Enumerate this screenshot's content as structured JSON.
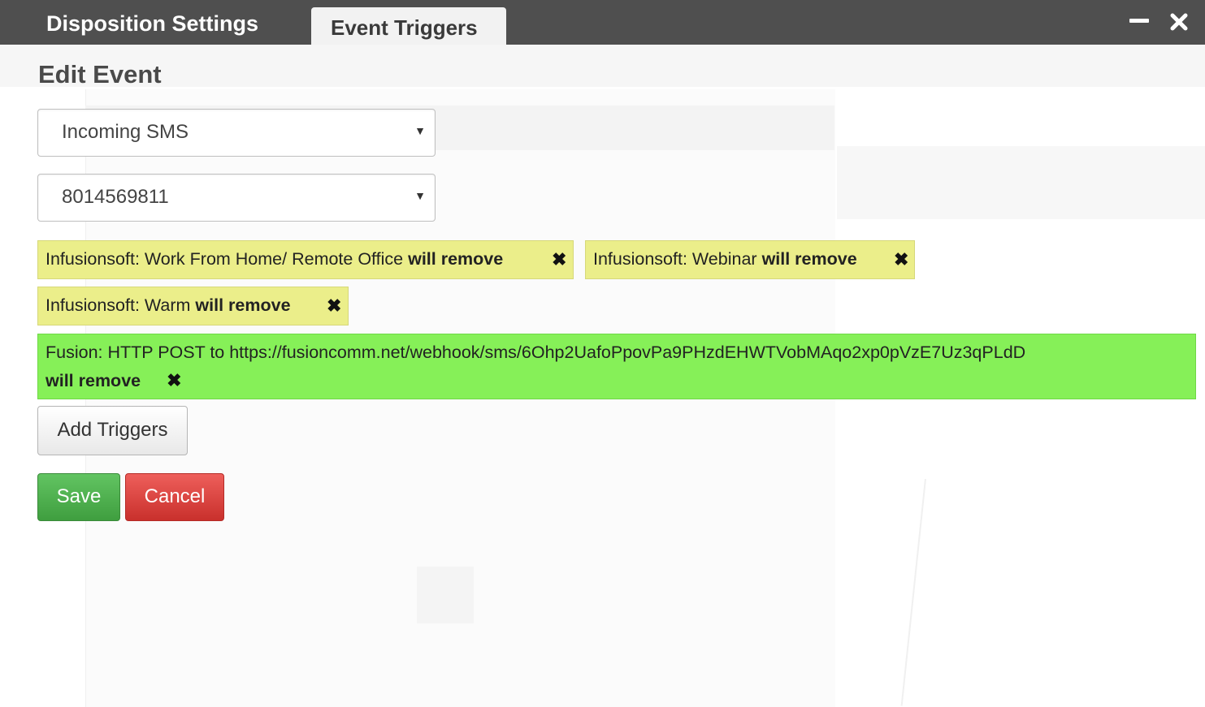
{
  "tabs": {
    "disposition_label": "Disposition Settings",
    "event_triggers_label": "Event Triggers"
  },
  "window": {
    "minimize_icon": "minimize-icon",
    "close_icon": "close-icon"
  },
  "dialog": {
    "heading": "Edit Event",
    "event_select_value": "Incoming SMS",
    "number_select_value": "8014569811"
  },
  "triggers": [
    {
      "text": "Infusionsoft: Work From Home/ Remote Office",
      "action": "will remove"
    },
    {
      "text": "Infusionsoft: Webinar",
      "action": "will remove"
    },
    {
      "text": "Infusionsoft: Warm",
      "action": "will remove"
    },
    {
      "text": "Fusion: HTTP POST to https://fusioncomm.net/webhook/sms/6Ohp2UafoPpovPa9PHzdEHWTVobMAqo2xp0pVzE7Uz3qPLdD",
      "action": "will remove"
    }
  ],
  "buttons": {
    "add_triggers": "Add Triggers",
    "save": "Save",
    "cancel": "Cancel"
  },
  "colors": {
    "tab_bar": "#4f4f4f",
    "chip_yellow": "#ebee8a",
    "chip_green": "#86f058",
    "save_green": "#4cae4c",
    "cancel_red": "#d9534f"
  }
}
